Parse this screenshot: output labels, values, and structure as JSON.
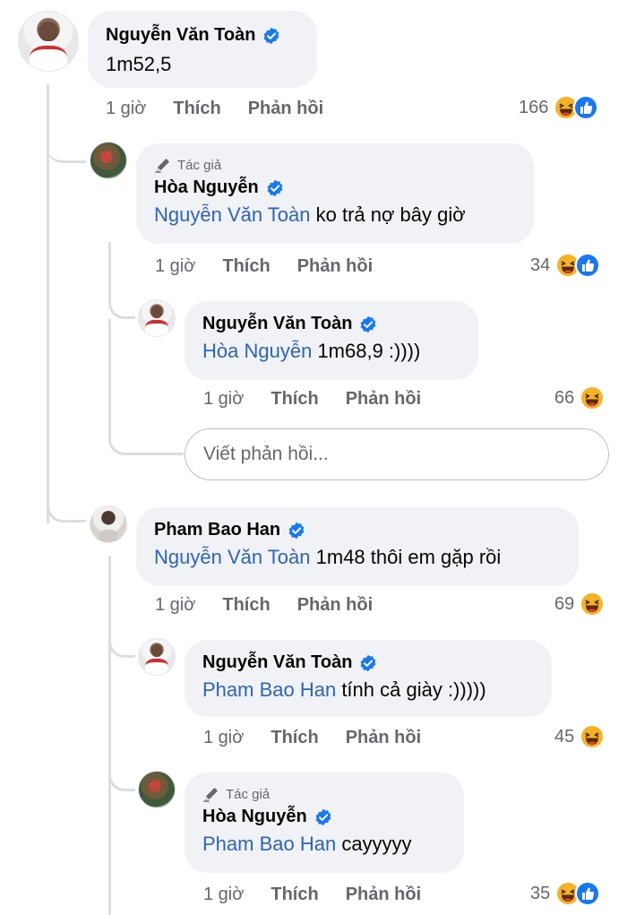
{
  "comments": [
    {
      "id": "c1",
      "author": "Nguyễn Văn Toàn",
      "author_tag": "",
      "mention": "",
      "text": "1m52,5",
      "time": "1 giờ",
      "like_label": "Thích",
      "reply_label": "Phản hồi",
      "reaction_count": "166",
      "reactions": [
        "haha",
        "like"
      ]
    },
    {
      "id": "c2",
      "author": "Hòa Nguyễn",
      "author_tag": "Tác giả",
      "mention": "Nguyễn Văn Toàn",
      "text": " ko trả nợ bây giờ",
      "time": "1 giờ",
      "like_label": "Thích",
      "reply_label": "Phản hồi",
      "reaction_count": "34",
      "reactions": [
        "haha",
        "like"
      ]
    },
    {
      "id": "c3",
      "author": "Nguyễn Văn Toàn",
      "author_tag": "",
      "mention": "Hòa Nguyễn",
      "text": " 1m68,9 :))))",
      "time": "1 giờ",
      "like_label": "Thích",
      "reply_label": "Phản hồi",
      "reaction_count": "66",
      "reactions": [
        "haha"
      ]
    },
    {
      "id": "c4",
      "author": "Pham Bao Han",
      "author_tag": "",
      "mention": "Nguyễn Văn Toàn",
      "text": " 1m48 thôi em gặp rồi",
      "time": "1 giờ",
      "like_label": "Thích",
      "reply_label": "Phản hồi",
      "reaction_count": "69",
      "reactions": [
        "haha"
      ]
    },
    {
      "id": "c5",
      "author": "Nguyễn Văn Toàn",
      "author_tag": "",
      "mention": "Pham Bao Han",
      "text": " tính cả giày :)))))",
      "time": "1 giờ",
      "like_label": "Thích",
      "reply_label": "Phản hồi",
      "reaction_count": "45",
      "reactions": [
        "haha"
      ]
    },
    {
      "id": "c6",
      "author": "Hòa Nguyễn",
      "author_tag": "Tác giả",
      "mention": "Pham Bao Han",
      "text": " cayyyyy",
      "time": "1 giờ",
      "like_label": "Thích",
      "reply_label": "Phản hồi",
      "reaction_count": "35",
      "reactions": [
        "haha",
        "like"
      ]
    }
  ],
  "reply_input": {
    "placeholder": "Viết phản hồi..."
  },
  "colors": {
    "bubble_bg": "#f0f2f5",
    "mention": "#2d64bc",
    "verified": "#1877f2",
    "meta_text": "#65676b",
    "thread_line": "#dadde1"
  },
  "icons": {
    "verified": "verified-badge-icon",
    "author_tag": "pencil-icon",
    "haha": "haha-reaction-icon",
    "like": "like-reaction-icon"
  }
}
